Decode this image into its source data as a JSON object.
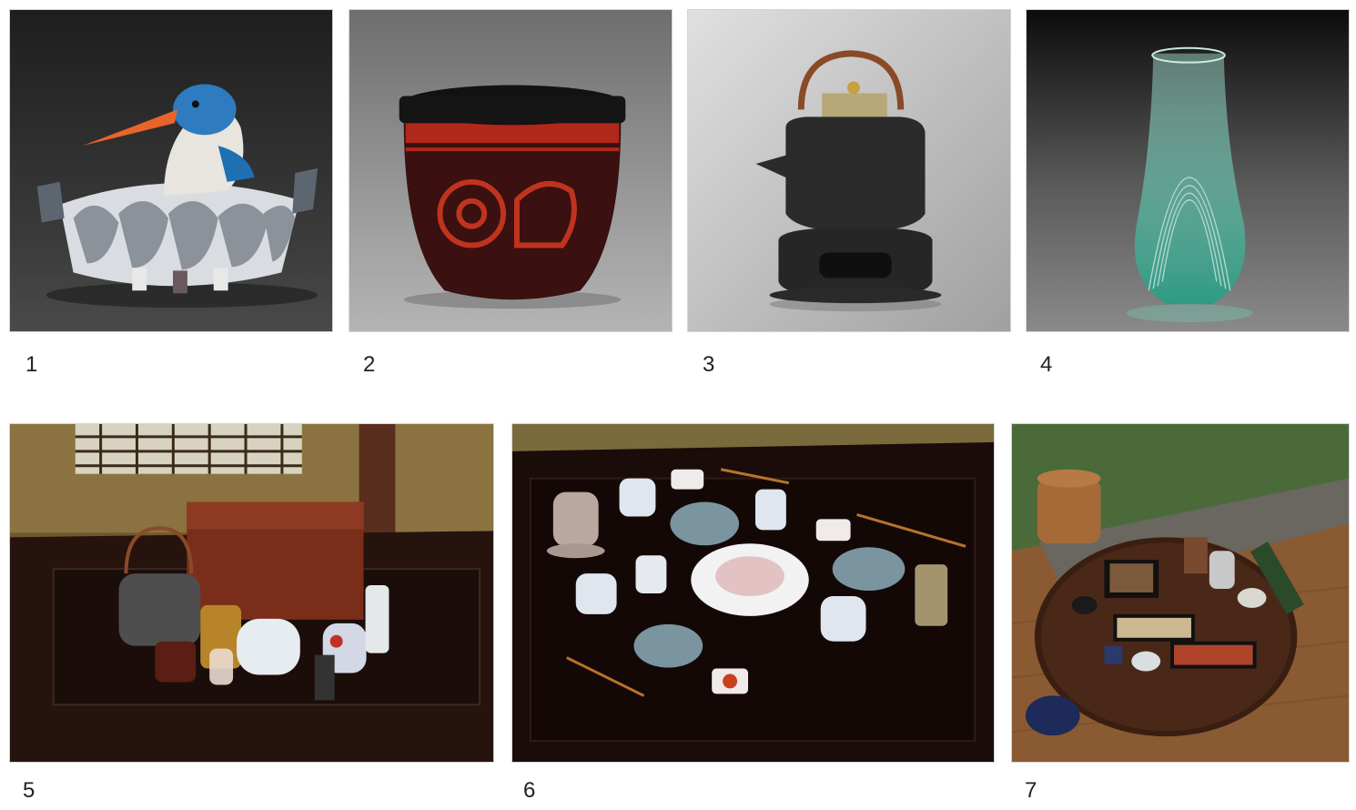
{
  "figures": [
    {
      "number": "1",
      "subject": "kingfisher-lotus-bowl"
    },
    {
      "number": "2",
      "subject": "red-black-lacquer-lidded-jar"
    },
    {
      "number": "3",
      "subject": "iron-kettle-on-brazier"
    },
    {
      "number": "4",
      "subject": "green-glass-vase"
    },
    {
      "number": "5",
      "subject": "tea-utensils-on-table"
    },
    {
      "number": "6",
      "subject": "table-setting-with-plates"
    },
    {
      "number": "7",
      "subject": "round-tray-with-bento-boxes"
    }
  ],
  "colors": {
    "page_background": "#ffffff",
    "dark_backdrop": "#2a2a2a",
    "gray_backdrop": "#8d8d8d",
    "lacquer_red": "#b0281a",
    "wood_table": "#2a1410",
    "glass_green": "#5fb3a0"
  }
}
